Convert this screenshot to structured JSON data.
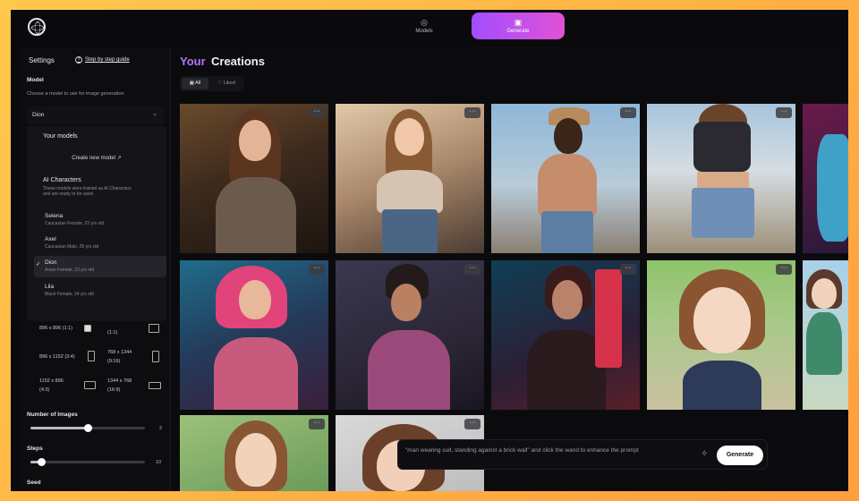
{
  "nav": {
    "models_label": "Models",
    "generate_label": "Generate"
  },
  "sidebar": {
    "settings": "Settings",
    "guide": "Step by step guide",
    "model_label": "Model",
    "model_hint": "Choose a model to use for image generation",
    "model_selected": "Dion",
    "dropdown": {
      "your_models": "Your models",
      "create_model": "Create new model",
      "ai_characters": "AI Characters",
      "ai_desc": "These models were trained as AI Characters and are ready to be used.",
      "characters": [
        {
          "name": "Selena",
          "desc": "Caucasian Female, 22 yrs old",
          "selected": false
        },
        {
          "name": "Axel",
          "desc": "Caucasian Male, 25 yrs old",
          "selected": false
        },
        {
          "name": "Dion",
          "desc": "Asian Female, 23 yrs old",
          "selected": true
        },
        {
          "name": "Lila",
          "desc": "Black Female, 24 yrs old",
          "selected": false
        }
      ]
    },
    "sizes": {
      "s1": "896 x 896 (1:1)",
      "s1b": "(1:1)",
      "s2": "896 x 1152 (3:4)",
      "s3": "768 x 1344",
      "s3b": "(9:16)",
      "s4": "1152 x 896",
      "s4b": "(4:3)",
      "s5": "1344 x 768",
      "s5b": "(16:9)"
    },
    "num_images_label": "Number of Images",
    "num_images_value": "2",
    "num_images_fraction": 0.5,
    "steps_label": "Steps",
    "steps_value": "10",
    "steps_fraction": 0.1,
    "seed_label": "Seed"
  },
  "main": {
    "title_your": "Your",
    "title_creations": "Creations",
    "filter_all": "All",
    "filter_liked": "Liked",
    "more_label": "···",
    "prompt_placeholder": "\"man wearing suit, standing against a brick wall\" and click the wand to enhance the prompt",
    "generate_button": "Generate"
  },
  "colors": {
    "accent_purple": "#b670ff",
    "generate_gradient_start": "#a34dff",
    "generate_gradient_end": "#e052d6",
    "background": "#0b0b0d"
  }
}
